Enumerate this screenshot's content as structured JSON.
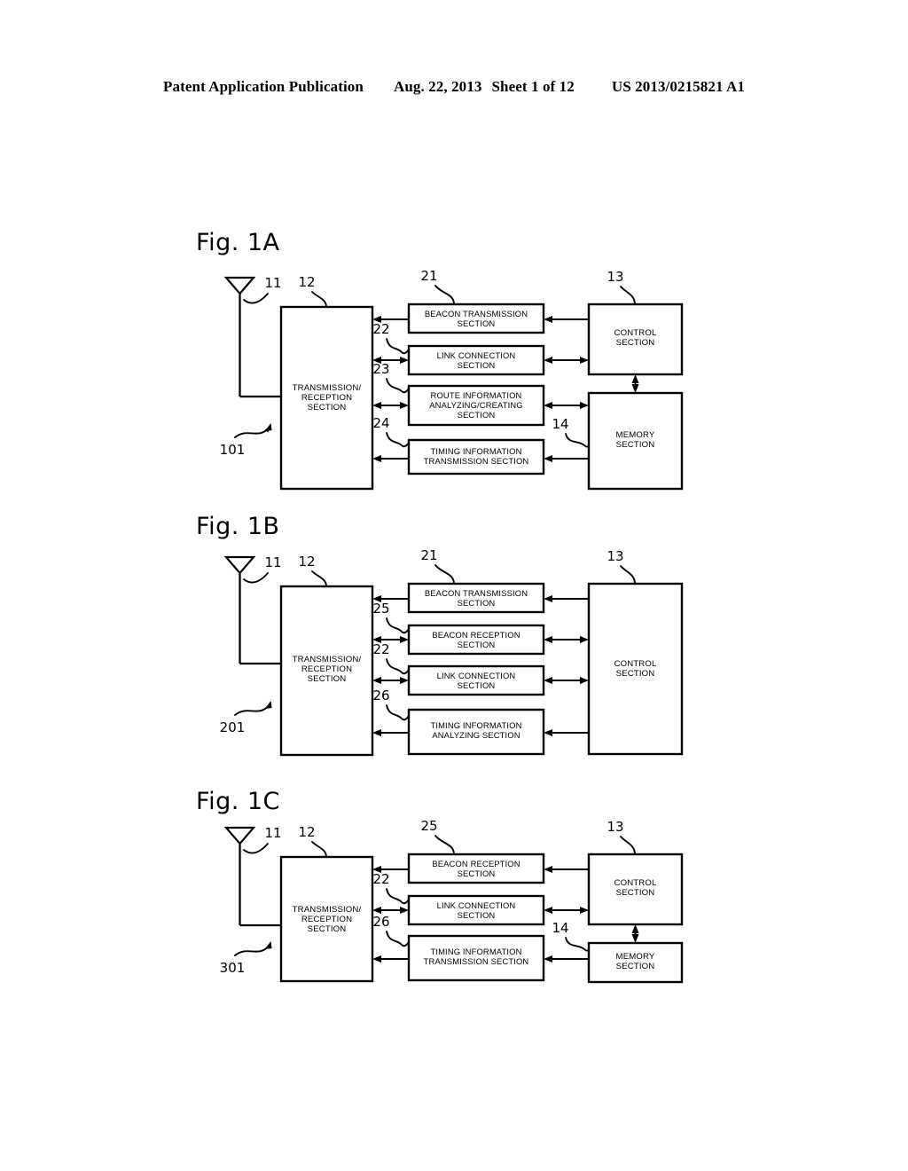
{
  "header": {
    "publication": "Patent Application Publication",
    "date": "Aug. 22, 2013",
    "sheet": "Sheet 1 of 12",
    "docnumber": "US 2013/0215821 A1"
  },
  "figures": [
    {
      "title": "Fig. 1A",
      "device_ref": "101",
      "antenna_ref": "11",
      "transceiver": {
        "ref": "12",
        "label_line1": "TRANSMISSION/",
        "label_line2": "RECEPTION",
        "label_line3": "SECTION"
      },
      "control": {
        "ref": "13",
        "label_line1": "CONTROL",
        "label_line2": "SECTION"
      },
      "memory": {
        "ref": "14",
        "label_line1": "MEMORY",
        "label_line2": "SECTION",
        "present": "yes"
      },
      "middle_blocks": [
        {
          "ref": "21",
          "lines": [
            "BEACON TRANSMISSION",
            "SECTION"
          ],
          "left_arrow": "single-left",
          "right_arrow": "single-left"
        },
        {
          "ref": "22",
          "lines": [
            "LINK CONNECTION",
            "SECTION"
          ],
          "left_arrow": "double",
          "right_arrow": "double"
        },
        {
          "ref": "23",
          "lines": [
            "ROUTE INFORMATION",
            "ANALYZING/CREATING",
            "SECTION"
          ],
          "left_arrow": "double",
          "right_arrow": "double"
        },
        {
          "ref": "24",
          "lines": [
            "TIMING INFORMATION",
            "TRANSMISSION SECTION"
          ],
          "left_arrow": "single-left",
          "right_arrow": "single-left"
        }
      ]
    },
    {
      "title": "Fig. 1B",
      "device_ref": "201",
      "antenna_ref": "11",
      "transceiver": {
        "ref": "12",
        "label_line1": "TRANSMISSION/",
        "label_line2": "RECEPTION",
        "label_line3": "SECTION"
      },
      "control": {
        "ref": "13",
        "label_line1": "CONTROL",
        "label_line2": "SECTION"
      },
      "memory": {
        "ref": "",
        "label_line1": "",
        "label_line2": "",
        "present": "no"
      },
      "middle_blocks": [
        {
          "ref": "21",
          "lines": [
            "BEACON TRANSMISSION",
            "SECTION"
          ],
          "left_arrow": "single-left",
          "right_arrow": "single-left"
        },
        {
          "ref": "25",
          "lines": [
            "BEACON RECEPTION",
            "SECTION"
          ],
          "left_arrow": "double",
          "right_arrow": "double"
        },
        {
          "ref": "22",
          "lines": [
            "LINK CONNECTION",
            "SECTION"
          ],
          "left_arrow": "double",
          "right_arrow": "double"
        },
        {
          "ref": "26",
          "lines": [
            "TIMING INFORMATION",
            "ANALYZING SECTION"
          ],
          "left_arrow": "single-left",
          "right_arrow": "single-left"
        }
      ]
    },
    {
      "title": "Fig. 1C",
      "device_ref": "301",
      "antenna_ref": "11",
      "transceiver": {
        "ref": "12",
        "label_line1": "TRANSMISSION/",
        "label_line2": "RECEPTION",
        "label_line3": "SECTION"
      },
      "control": {
        "ref": "13",
        "label_line1": "CONTROL",
        "label_line2": "SECTION"
      },
      "memory": {
        "ref": "14",
        "label_line1": "MEMORY",
        "label_line2": "SECTION",
        "present": "yes"
      },
      "middle_blocks": [
        {
          "ref": "25",
          "lines": [
            "BEACON RECEPTION",
            "SECTION"
          ],
          "left_arrow": "single-left",
          "right_arrow": "single-left"
        },
        {
          "ref": "22",
          "lines": [
            "LINK CONNECTION",
            "SECTION"
          ],
          "left_arrow": "double",
          "right_arrow": "double"
        },
        {
          "ref": "26",
          "lines": [
            "TIMING INFORMATION",
            "TRANSMISSION SECTION"
          ],
          "left_arrow": "single-left",
          "right_arrow": "single-left"
        }
      ]
    }
  ],
  "colors": {
    "ink": "#000000",
    "paper": "#ffffff"
  }
}
